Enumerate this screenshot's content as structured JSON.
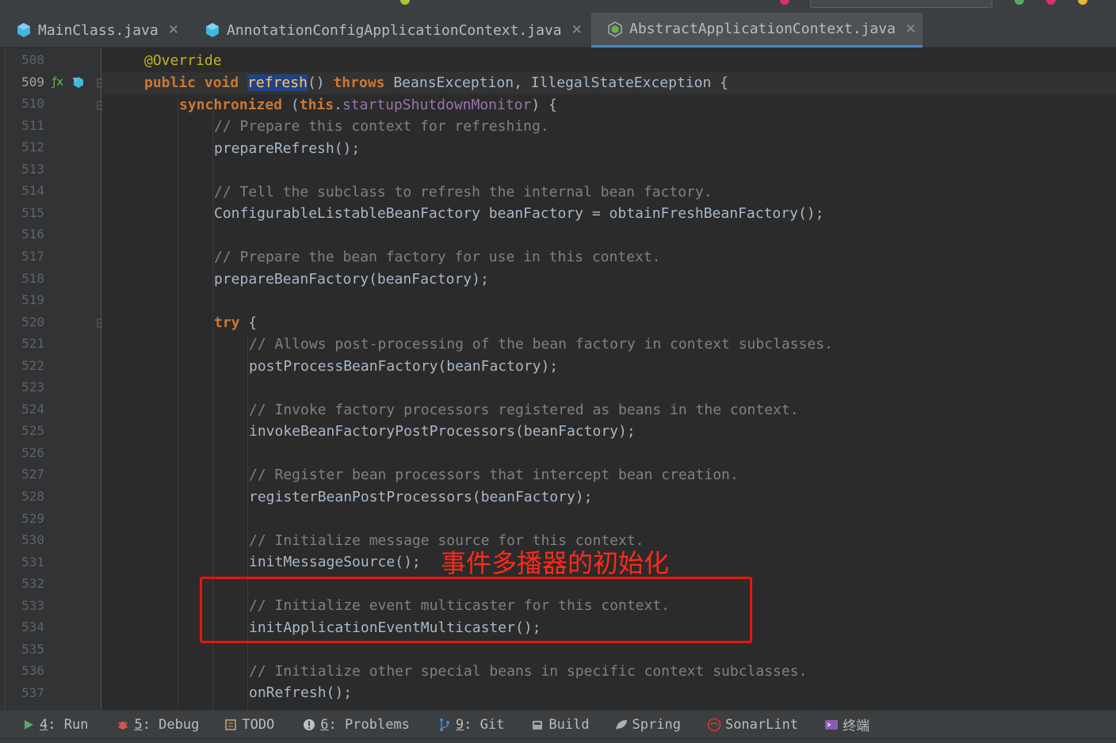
{
  "tabs": [
    {
      "label": "MainClass.java",
      "active": false,
      "icon": "java-class-icon"
    },
    {
      "label": "AnnotationConfigApplicationContext.java",
      "active": false,
      "icon": "java-class-icon"
    },
    {
      "label": "AbstractApplicationContext.java",
      "active": true,
      "icon": "abstract-class-icon"
    }
  ],
  "gutter": {
    "line_numbers": [
      "508",
      "509",
      "510",
      "511",
      "512",
      "513",
      "514",
      "515",
      "516",
      "517",
      "518",
      "519",
      "520",
      "521",
      "522",
      "523",
      "524",
      "525",
      "526",
      "527",
      "528",
      "529",
      "530",
      "531",
      "532",
      "533",
      "534",
      "535",
      "536",
      "537"
    ],
    "current_line": "509"
  },
  "code": {
    "l508": "@Override",
    "l509_kw1": "public",
    "l509_kw2": "void",
    "l509_name": "refresh",
    "l509_paren": "()",
    "l509_throws": "throws",
    "l509_ex1": "BeansException",
    "l509_comma": ",",
    "l509_ex2": "IllegalStateException",
    "l509_brace": "{",
    "l510_kw": "synchronized",
    "l510_open": "(",
    "l510_this": "this",
    "l510_dot": ".",
    "l510_field": "startupShutdownMonitor",
    "l510_close": ") {",
    "l511": "// Prepare this context for refreshing.",
    "l512_m": "prepareRefresh",
    "l512_e": "();",
    "l514": "// Tell the subclass to refresh the internal bean factory.",
    "l515_t": "ConfigurableListableBeanFactory",
    "l515_v": " beanFactory = ",
    "l515_m": "obtainFreshBeanFactory",
    "l515_e": "();",
    "l517": "// Prepare the bean factory for use in this context.",
    "l518_m": "prepareBeanFactory",
    "l518_e": "(beanFactory);",
    "l520_kw": "try",
    "l520_b": " {",
    "l521": "// Allows post-processing of the bean factory in context subclasses.",
    "l522_m": "postProcessBeanFactory",
    "l522_e": "(beanFactory);",
    "l524": "// Invoke factory processors registered as beans in the context.",
    "l525_m": "invokeBeanFactoryPostProcessors",
    "l525_e": "(beanFactory);",
    "l527": "// Register bean processors that intercept bean creation.",
    "l528_m": "registerBeanPostProcessors",
    "l528_e": "(beanFactory);",
    "l530": "// Initialize message source for this context.",
    "l531_m": "initMessageSource",
    "l531_e": "();",
    "l533": "// Initialize event multicaster for this context.",
    "l534_m": "initApplicationEventMulticaster",
    "l534_e": "();",
    "l536": "// Initialize other special beans in specific context subclasses.",
    "l537_m": "onRefresh",
    "l537_e": "();"
  },
  "annotation": {
    "text": "事件多播器的初始化",
    "color": "#e8160c"
  },
  "toolbar": [
    {
      "num": "4",
      "label": ": Run",
      "icon": "run-icon"
    },
    {
      "num": "5",
      "label": ": Debug",
      "icon": "debug-bug-icon"
    },
    {
      "num": "",
      "label": "TODO",
      "icon": "todo-icon"
    },
    {
      "num": "6",
      "label": ": Problems",
      "icon": "problems-icon"
    },
    {
      "num": "9",
      "label": ": Git",
      "icon": "git-branch-icon"
    },
    {
      "num": "",
      "label": "Build",
      "icon": "build-icon"
    },
    {
      "num": "",
      "label": "Spring",
      "icon": "spring-leaf-icon"
    },
    {
      "num": "",
      "label": "SonarLint",
      "icon": "sonarlint-icon"
    },
    {
      "num": "",
      "label": "终端",
      "icon": "terminal-icon"
    }
  ],
  "colors": {
    "keyword": "#cc7832",
    "method_decl": "#ffc66d",
    "field": "#9876aa",
    "comment": "#808080",
    "annotation": "#bbb529",
    "accent": "#4a88c7"
  }
}
